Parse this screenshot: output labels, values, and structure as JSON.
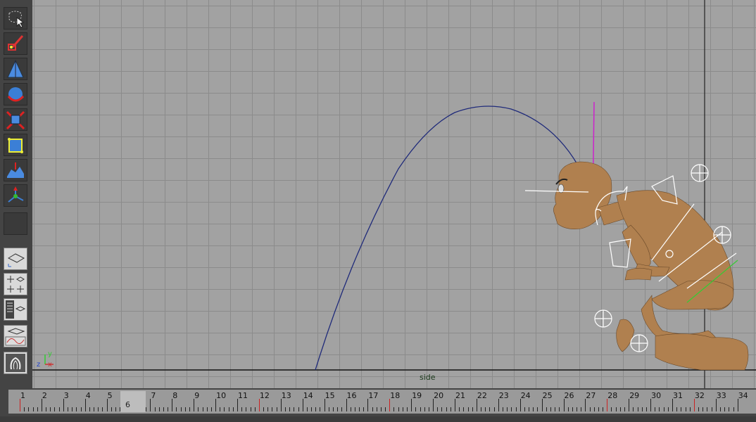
{
  "viewport": {
    "camera_label": "side",
    "axis_labels": {
      "y": "y",
      "z": "z",
      "x": "x"
    }
  },
  "timeline": {
    "frames": [
      "1",
      "2",
      "3",
      "4",
      "5",
      "6",
      "7",
      "8",
      "9",
      "10",
      "11",
      "12",
      "13",
      "14",
      "15",
      "16",
      "17",
      "18",
      "19",
      "20",
      "21",
      "22",
      "23",
      "24",
      "25",
      "26",
      "27",
      "28",
      "29",
      "30",
      "31",
      "32",
      "33",
      "34"
    ],
    "current_frame": "6",
    "key_frames": [
      1,
      12,
      18,
      28,
      32
    ]
  },
  "toolbox": {
    "tools": [
      {
        "name": "lasso-select-icon"
      },
      {
        "name": "paint-select-icon"
      },
      {
        "name": "move-tool-icon"
      },
      {
        "name": "rotate-tool-icon"
      },
      {
        "name": "scale-tool-icon"
      },
      {
        "name": "universal-manipulator-icon"
      },
      {
        "name": "soft-modification-icon"
      },
      {
        "name": "show-manipulator-icon"
      },
      {
        "name": "last-tool-icon"
      }
    ],
    "layouts": [
      {
        "name": "single-perspective-layout-icon"
      },
      {
        "name": "four-view-layout-icon"
      },
      {
        "name": "outliner-persp-layout-icon"
      },
      {
        "name": "persp-graph-layout-icon"
      },
      {
        "name": "hypershade-layout-icon"
      }
    ],
    "accent_color": "#3b7fd6"
  },
  "colors": {
    "viewport_bg": "#a2a2a2",
    "grid_line": "#8b8b8b",
    "motion_path": "#1f2a7a",
    "character_skin": "#b0804f",
    "manipulator": "#ffffff",
    "magenta_line": "#cc22cc"
  }
}
